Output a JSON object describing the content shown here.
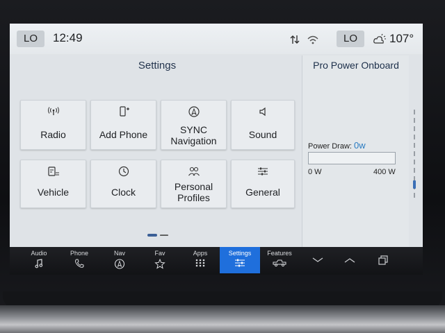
{
  "status": {
    "left_climate": "LO",
    "time": "12:49",
    "right_climate": "LO",
    "temperature": "107°",
    "icons": [
      "data-transfer-icon",
      "wifi-icon",
      "weather-icon"
    ]
  },
  "settings": {
    "title": "Settings",
    "tiles": [
      {
        "label": "Radio",
        "icon": "radio-antenna-icon"
      },
      {
        "label": "Add Phone",
        "icon": "add-phone-icon"
      },
      {
        "label": "SYNC Navigation",
        "line1": "SYNC",
        "line2": "Navigation",
        "icon": "navigation-icon"
      },
      {
        "label": "Sound",
        "icon": "speaker-icon"
      },
      {
        "label": "Vehicle",
        "icon": "vehicle-settings-icon"
      },
      {
        "label": "Clock",
        "icon": "clock-icon"
      },
      {
        "label": "Personal Profiles",
        "line1": "Personal",
        "line2": "Profiles",
        "icon": "profiles-icon"
      },
      {
        "label": "General",
        "icon": "sliders-icon"
      }
    ],
    "page_indicator": {
      "pages": 2,
      "current": 1
    }
  },
  "pro_power": {
    "title": "Pro Power Onboard",
    "draw_label": "Power Draw:",
    "draw_value": "0w",
    "min_label": "0 W",
    "max_label": "400 W",
    "draw_fraction": 0
  },
  "nav": {
    "items": [
      {
        "label": "Audio",
        "icon": "music-note-icon"
      },
      {
        "label": "Phone",
        "icon": "phone-icon"
      },
      {
        "label": "Nav",
        "icon": "navigation-icon"
      },
      {
        "label": "Fav",
        "icon": "star-icon"
      },
      {
        "label": "Apps",
        "icon": "apps-grid-icon"
      },
      {
        "label": "Settings",
        "icon": "sliders-icon",
        "active": true
      },
      {
        "label": "Features",
        "icon": "truck-icon"
      }
    ],
    "buttons": [
      "chevron-down-icon",
      "chevron-up-icon",
      "copy-windows-icon"
    ]
  },
  "colors": {
    "accent": "#1f6fdc",
    "title_blue": "#23344d",
    "value_blue": "#2a7cc2"
  }
}
